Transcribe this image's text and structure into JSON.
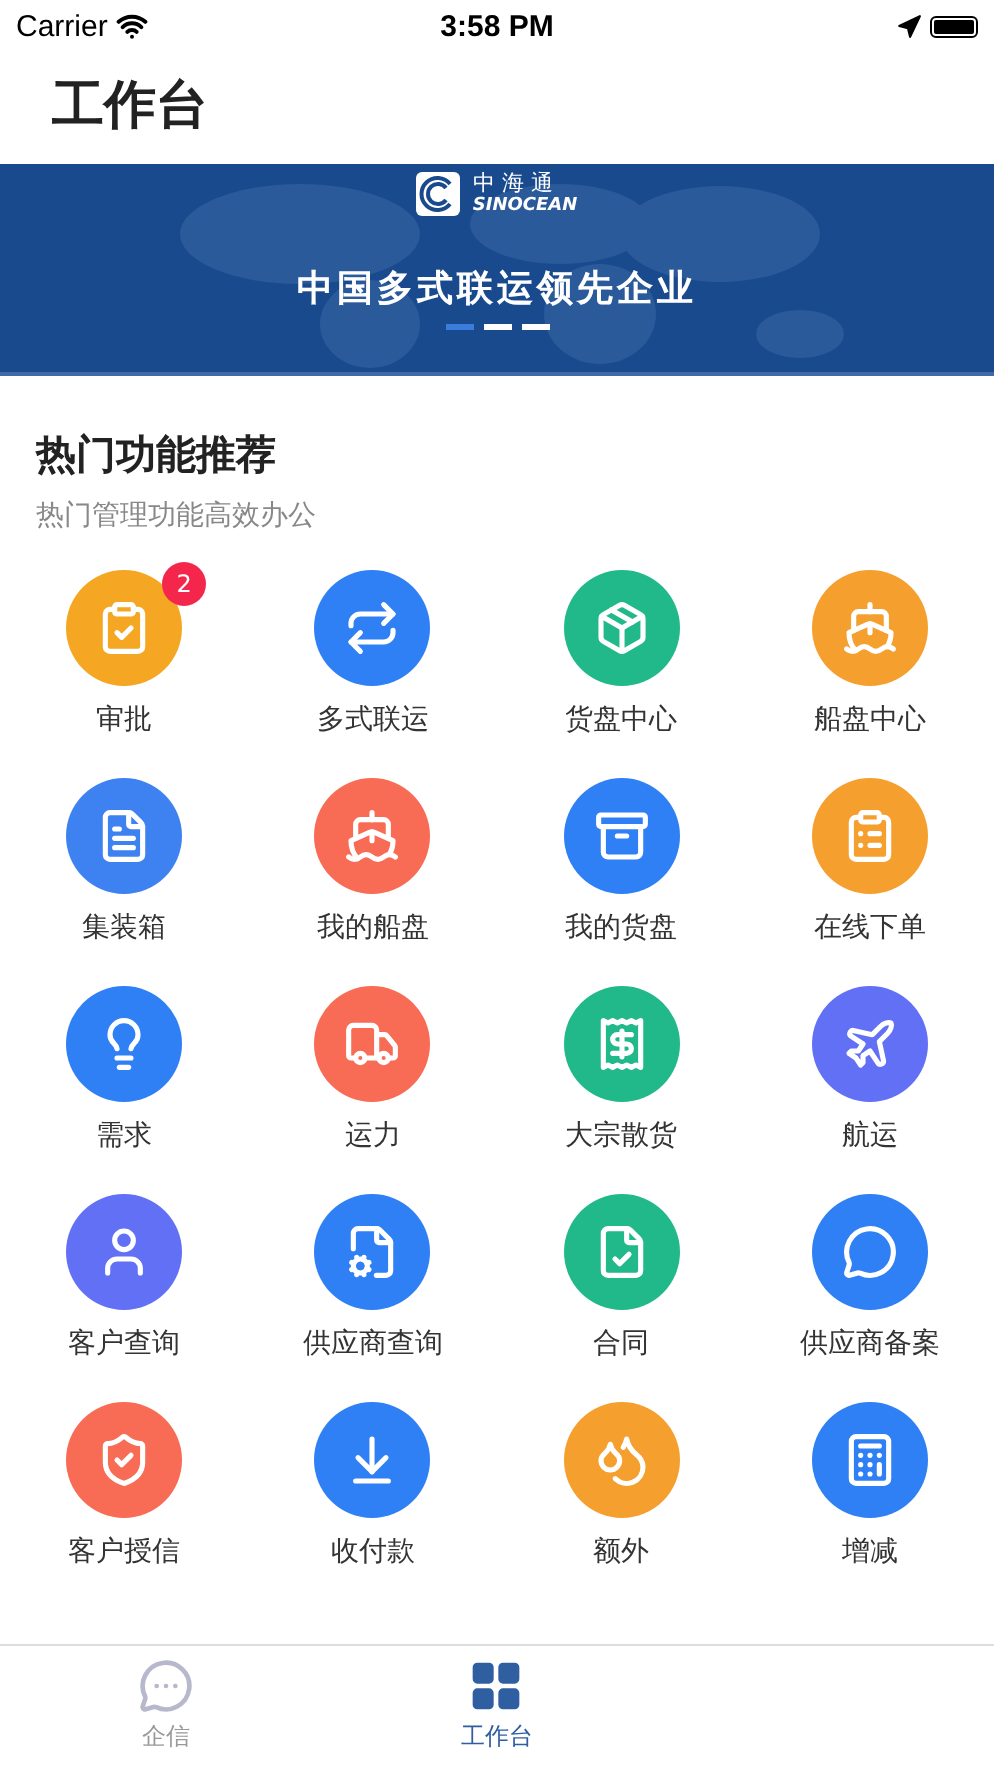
{
  "status_bar": {
    "carrier": "Carrier",
    "time": "3:58 PM"
  },
  "header": {
    "title": "工作台"
  },
  "banner": {
    "logo_cn": "中 海 通",
    "logo_en": "SINOCEAN",
    "slogan": "中国多式联运领先企业",
    "dots": [
      {
        "selected": true
      },
      {
        "selected": false
      },
      {
        "selected": false
      }
    ]
  },
  "section": {
    "title": "热门功能推荐",
    "subtitle": "热门管理功能高效办公"
  },
  "functions": [
    {
      "label": "审批",
      "color": "#f5a623",
      "badge": "2"
    },
    {
      "label": "多式联运",
      "color": "#2f7ff5"
    },
    {
      "label": "货盘中心",
      "color": "#22b98a"
    },
    {
      "label": "船盘中心",
      "color": "#f5a02e"
    },
    {
      "label": "集装箱",
      "color": "#3d82f0"
    },
    {
      "label": "我的船盘",
      "color": "#f86b55"
    },
    {
      "label": "我的货盘",
      "color": "#2f7ff5"
    },
    {
      "label": "在线下单",
      "color": "#f5a02e"
    },
    {
      "label": "需求",
      "color": "#2f7ff5"
    },
    {
      "label": "运力",
      "color": "#f86b55"
    },
    {
      "label": "大宗散货",
      "color": "#22b98a"
    },
    {
      "label": "航运",
      "color": "#6170f5"
    },
    {
      "label": "客户查询",
      "color": "#6170f5"
    },
    {
      "label": "供应商查询",
      "color": "#2f7ff5"
    },
    {
      "label": "合同",
      "color": "#22b98a"
    },
    {
      "label": "供应商备案",
      "color": "#2f7ff5"
    },
    {
      "label": "客户授信",
      "color": "#f86b55"
    },
    {
      "label": "收付款",
      "color": "#2f7ff5"
    },
    {
      "label": "额外",
      "color": "#f5a02e"
    },
    {
      "label": "增减",
      "color": "#2f7ff5"
    }
  ],
  "tab_bar": [
    {
      "label": "企信",
      "selected": false
    },
    {
      "label": "工作台",
      "selected": true
    }
  ]
}
